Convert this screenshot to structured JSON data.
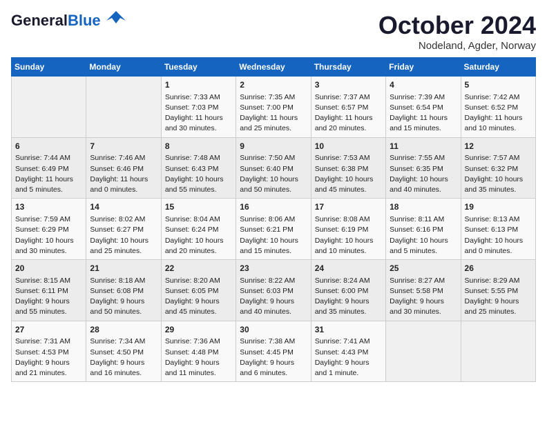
{
  "header": {
    "logo_general": "General",
    "logo_blue": "Blue",
    "month": "October 2024",
    "location": "Nodeland, Agder, Norway"
  },
  "days_of_week": [
    "Sunday",
    "Monday",
    "Tuesday",
    "Wednesday",
    "Thursday",
    "Friday",
    "Saturday"
  ],
  "weeks": [
    [
      {
        "day": "",
        "info": ""
      },
      {
        "day": "",
        "info": ""
      },
      {
        "day": "1",
        "info": "Sunrise: 7:33 AM\nSunset: 7:03 PM\nDaylight: 11 hours\nand 30 minutes."
      },
      {
        "day": "2",
        "info": "Sunrise: 7:35 AM\nSunset: 7:00 PM\nDaylight: 11 hours\nand 25 minutes."
      },
      {
        "day": "3",
        "info": "Sunrise: 7:37 AM\nSunset: 6:57 PM\nDaylight: 11 hours\nand 20 minutes."
      },
      {
        "day": "4",
        "info": "Sunrise: 7:39 AM\nSunset: 6:54 PM\nDaylight: 11 hours\nand 15 minutes."
      },
      {
        "day": "5",
        "info": "Sunrise: 7:42 AM\nSunset: 6:52 PM\nDaylight: 11 hours\nand 10 minutes."
      }
    ],
    [
      {
        "day": "6",
        "info": "Sunrise: 7:44 AM\nSunset: 6:49 PM\nDaylight: 11 hours\nand 5 minutes."
      },
      {
        "day": "7",
        "info": "Sunrise: 7:46 AM\nSunset: 6:46 PM\nDaylight: 11 hours\nand 0 minutes."
      },
      {
        "day": "8",
        "info": "Sunrise: 7:48 AM\nSunset: 6:43 PM\nDaylight: 10 hours\nand 55 minutes."
      },
      {
        "day": "9",
        "info": "Sunrise: 7:50 AM\nSunset: 6:40 PM\nDaylight: 10 hours\nand 50 minutes."
      },
      {
        "day": "10",
        "info": "Sunrise: 7:53 AM\nSunset: 6:38 PM\nDaylight: 10 hours\nand 45 minutes."
      },
      {
        "day": "11",
        "info": "Sunrise: 7:55 AM\nSunset: 6:35 PM\nDaylight: 10 hours\nand 40 minutes."
      },
      {
        "day": "12",
        "info": "Sunrise: 7:57 AM\nSunset: 6:32 PM\nDaylight: 10 hours\nand 35 minutes."
      }
    ],
    [
      {
        "day": "13",
        "info": "Sunrise: 7:59 AM\nSunset: 6:29 PM\nDaylight: 10 hours\nand 30 minutes."
      },
      {
        "day": "14",
        "info": "Sunrise: 8:02 AM\nSunset: 6:27 PM\nDaylight: 10 hours\nand 25 minutes."
      },
      {
        "day": "15",
        "info": "Sunrise: 8:04 AM\nSunset: 6:24 PM\nDaylight: 10 hours\nand 20 minutes."
      },
      {
        "day": "16",
        "info": "Sunrise: 8:06 AM\nSunset: 6:21 PM\nDaylight: 10 hours\nand 15 minutes."
      },
      {
        "day": "17",
        "info": "Sunrise: 8:08 AM\nSunset: 6:19 PM\nDaylight: 10 hours\nand 10 minutes."
      },
      {
        "day": "18",
        "info": "Sunrise: 8:11 AM\nSunset: 6:16 PM\nDaylight: 10 hours\nand 5 minutes."
      },
      {
        "day": "19",
        "info": "Sunrise: 8:13 AM\nSunset: 6:13 PM\nDaylight: 10 hours\nand 0 minutes."
      }
    ],
    [
      {
        "day": "20",
        "info": "Sunrise: 8:15 AM\nSunset: 6:11 PM\nDaylight: 9 hours\nand 55 minutes."
      },
      {
        "day": "21",
        "info": "Sunrise: 8:18 AM\nSunset: 6:08 PM\nDaylight: 9 hours\nand 50 minutes."
      },
      {
        "day": "22",
        "info": "Sunrise: 8:20 AM\nSunset: 6:05 PM\nDaylight: 9 hours\nand 45 minutes."
      },
      {
        "day": "23",
        "info": "Sunrise: 8:22 AM\nSunset: 6:03 PM\nDaylight: 9 hours\nand 40 minutes."
      },
      {
        "day": "24",
        "info": "Sunrise: 8:24 AM\nSunset: 6:00 PM\nDaylight: 9 hours\nand 35 minutes."
      },
      {
        "day": "25",
        "info": "Sunrise: 8:27 AM\nSunset: 5:58 PM\nDaylight: 9 hours\nand 30 minutes."
      },
      {
        "day": "26",
        "info": "Sunrise: 8:29 AM\nSunset: 5:55 PM\nDaylight: 9 hours\nand 25 minutes."
      }
    ],
    [
      {
        "day": "27",
        "info": "Sunrise: 7:31 AM\nSunset: 4:53 PM\nDaylight: 9 hours\nand 21 minutes."
      },
      {
        "day": "28",
        "info": "Sunrise: 7:34 AM\nSunset: 4:50 PM\nDaylight: 9 hours\nand 16 minutes."
      },
      {
        "day": "29",
        "info": "Sunrise: 7:36 AM\nSunset: 4:48 PM\nDaylight: 9 hours\nand 11 minutes."
      },
      {
        "day": "30",
        "info": "Sunrise: 7:38 AM\nSunset: 4:45 PM\nDaylight: 9 hours\nand 6 minutes."
      },
      {
        "day": "31",
        "info": "Sunrise: 7:41 AM\nSunset: 4:43 PM\nDaylight: 9 hours\nand 1 minute."
      },
      {
        "day": "",
        "info": ""
      },
      {
        "day": "",
        "info": ""
      }
    ]
  ]
}
